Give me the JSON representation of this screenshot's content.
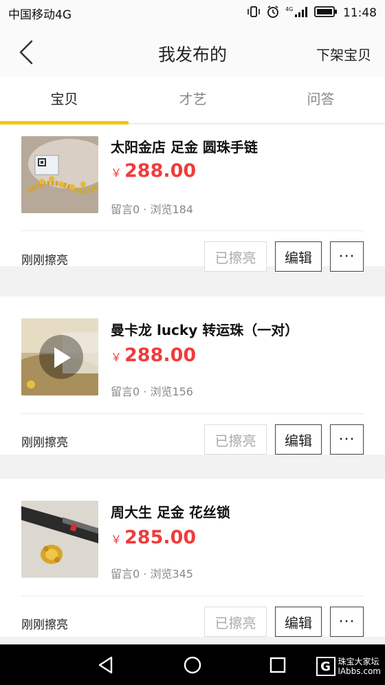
{
  "status_bar": {
    "carrier": "中国移动4G",
    "time": "11:48",
    "network": "4G"
  },
  "header": {
    "title": "我发布的",
    "action": "下架宝贝"
  },
  "tabs": [
    {
      "label": "宝贝",
      "active": true
    },
    {
      "label": "才艺",
      "active": false
    },
    {
      "label": "问答",
      "active": false
    }
  ],
  "items": [
    {
      "title": "太阳金店 足金 圆珠手链",
      "currency": "￥",
      "price": "288.00",
      "stats": "留言0 · 浏览184",
      "time": "刚刚擦亮",
      "bright_label": "已擦亮",
      "edit_label": "编辑",
      "more_label": "···",
      "has_video": false
    },
    {
      "title": "曼卡龙 lucky 转运珠（一对）",
      "currency": "￥",
      "price": "288.00",
      "stats": "留言0 · 浏览156",
      "time": "刚刚擦亮",
      "bright_label": "已擦亮",
      "edit_label": "编辑",
      "more_label": "···",
      "has_video": true
    },
    {
      "title": "周大生 足金 花丝锁",
      "currency": "￥",
      "price": "285.00",
      "stats": "留言0 · 浏览345",
      "time": "刚刚擦亮",
      "bright_label": "已擦亮",
      "edit_label": "编辑",
      "more_label": "···",
      "has_video": false
    }
  ],
  "watermark": {
    "letter": "G",
    "line1": "珠宝大家坛",
    "line2": "lAbbs.com"
  },
  "colors": {
    "accent": "#f7c500",
    "price": "#f03c3c"
  }
}
